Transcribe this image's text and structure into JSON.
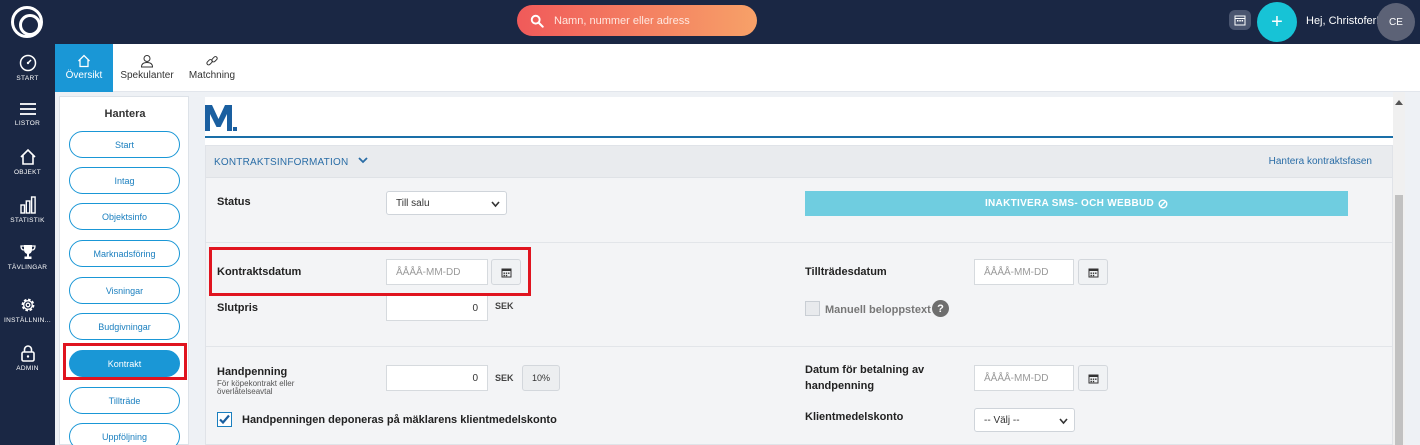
{
  "topbar": {
    "search_placeholder": "Namn, nummer eller adress",
    "greeting": "Hej, Christofer!",
    "avatar_initials": "CE",
    "plus_label": "+"
  },
  "leftnav": {
    "items": [
      {
        "label": "START",
        "icon": "speedometer-icon"
      },
      {
        "label": "LISTOR",
        "icon": "list-icon"
      },
      {
        "label": "OBJEKT",
        "icon": "home-icon"
      },
      {
        "label": "STATISTIK",
        "icon": "bar-chart-icon"
      },
      {
        "label": "TÄVLINGAR",
        "icon": "trophy-icon"
      },
      {
        "label": "INSTÄLLNIN...",
        "icon": "gear-icon"
      },
      {
        "label": "ADMIN",
        "icon": "lock-icon"
      }
    ]
  },
  "tabs": [
    {
      "label": "Översikt",
      "icon": "home-icon",
      "active": true
    },
    {
      "label": "Spekulanter",
      "icon": "user-icon",
      "active": false
    },
    {
      "label": "Matchning",
      "icon": "link-icon",
      "active": false
    }
  ],
  "manage": {
    "title": "Hantera",
    "items": [
      "Start",
      "Intag",
      "Objektsinfo",
      "Marknadsföring",
      "Visningar",
      "Budgivningar",
      "Kontrakt",
      "Tillträde",
      "Uppföljning"
    ],
    "active_item": "Kontrakt"
  },
  "section": {
    "title": "KONTRAKTSINFORMATION",
    "link": "Hantera kontraktsfasen"
  },
  "form": {
    "status_label": "Status",
    "status_value": "Till salu",
    "inactivate_button": "INAKTIVERA SMS- OCH WEBBUD",
    "kontraktsdatum_label": "Kontraktsdatum",
    "date_placeholder": "ÅÅÅÅ-MM-DD",
    "tilltradesdatum_label": "Tillträdesdatum",
    "slutpris_label": "Slutpris",
    "slutpris_value": "0",
    "currency": "SEK",
    "manuell_label": "Manuell beloppstext",
    "handpenning_label": "Handpenning",
    "handpenning_sub_1": "För köpekontrakt eller",
    "handpenning_sub_2": "överlåtelseavtal",
    "handpenning_value": "0",
    "percent_button": "10%",
    "datum_betalning_label_1": "Datum för betalning av",
    "datum_betalning_label_2": "handpenning",
    "deponeras_label": "Handpenningen deponeras på mäklarens klientmedelskonto",
    "klientmedelskonto_label": "Klientmedelskonto",
    "klientmedelskonto_value": "-- Välj --"
  },
  "colors": {
    "navy": "#1a2744",
    "accent_blue": "#1a97d6",
    "highlight_red": "#e0141f",
    "inactivate_bg": "#6fcde0"
  }
}
